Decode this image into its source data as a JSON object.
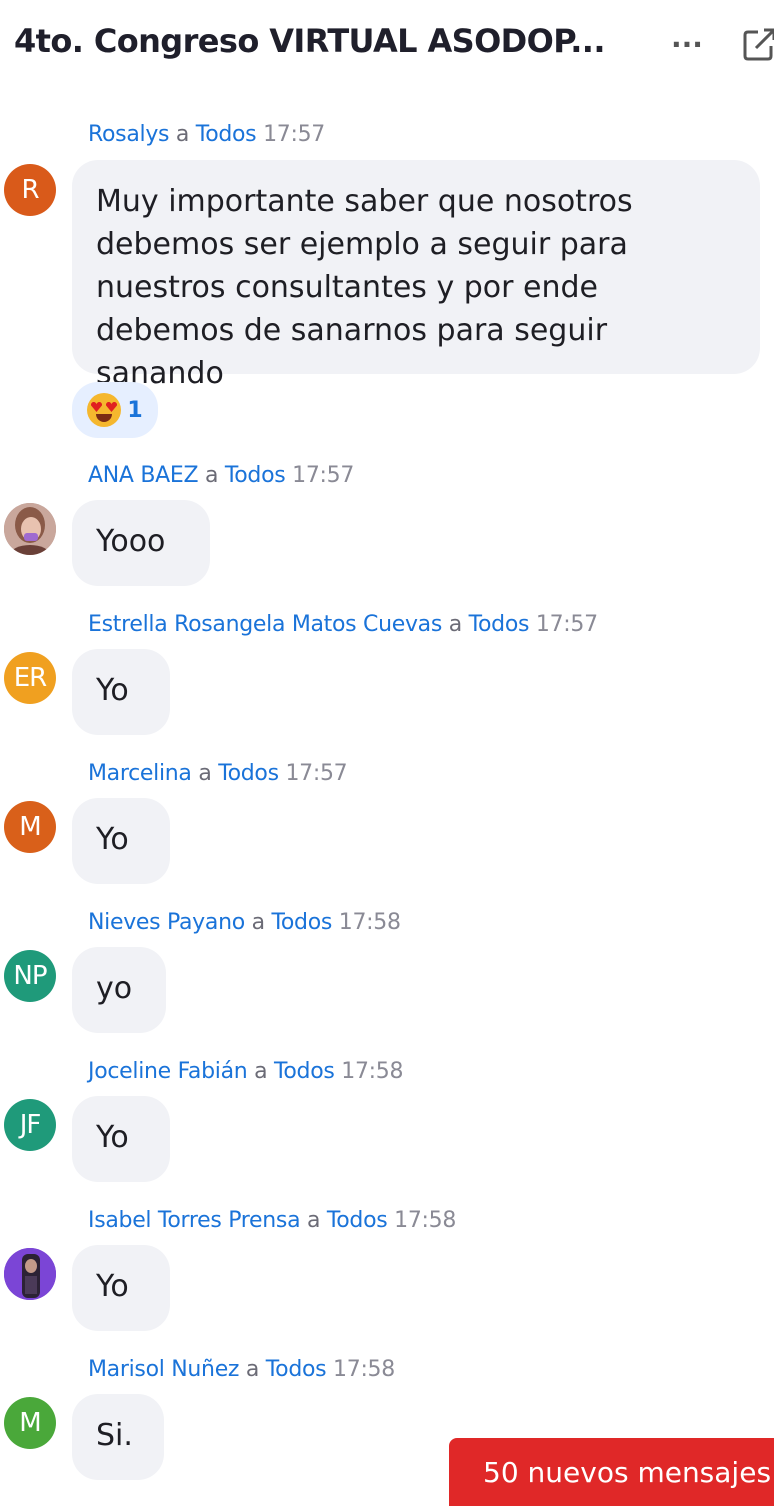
{
  "header": {
    "title": "4to. Congreso VIRTUAL ASODOP...",
    "more_icon": "more-horizontal-icon",
    "popout_icon": "pop-out-icon"
  },
  "messages": [
    {
      "sender": "Rosalys",
      "to": "a",
      "audience": "Todos",
      "time": "17:57",
      "avatar_text": "R",
      "avatar_color": "#d95a1a",
      "text": "Muy importante saber que nosotros debemos ser ejemplo a seguir para nuestros consultantes y por ende debemos de sanarnos para seguir sanando",
      "reaction": {
        "emoji": "heart-eyes-emoji",
        "count": "1"
      }
    },
    {
      "sender": "ANA BAEZ",
      "to": "a",
      "audience": "Todos",
      "time": "17:57",
      "avatar_text": "",
      "avatar_color": "#b48d86",
      "text": "Yooo"
    },
    {
      "sender": "Estrella Rosangela Matos Cuevas",
      "to": "a",
      "audience": "Todos",
      "time": "17:57",
      "avatar_text": "ER",
      "avatar_color": "#f0a020",
      "text": "Yo"
    },
    {
      "sender": "Marcelina",
      "to": "a",
      "audience": "Todos",
      "time": "17:57",
      "avatar_text": "M",
      "avatar_color": "#d9601a",
      "text": "Yo"
    },
    {
      "sender": "Nieves Payano",
      "to": "a",
      "audience": "Todos",
      "time": "17:58",
      "avatar_text": "NP",
      "avatar_color": "#1f9a7a",
      "text": "yo"
    },
    {
      "sender": "Joceline Fabián",
      "to": "a",
      "audience": "Todos",
      "time": "17:58",
      "avatar_text": "JF",
      "avatar_color": "#1f9a7a",
      "text": "Yo"
    },
    {
      "sender": "Isabel Torres Prensa",
      "to": "a",
      "audience": "Todos",
      "time": "17:58",
      "avatar_text": "",
      "avatar_color": "#6a35c8",
      "text": "Yo"
    },
    {
      "sender": "Marisol Nuñez",
      "to": "a",
      "audience": "Todos",
      "time": "17:58",
      "avatar_text": "M",
      "avatar_color": "#4aa83a",
      "text": "Si."
    }
  ],
  "new_messages_label": "50 nuevos mensajes"
}
